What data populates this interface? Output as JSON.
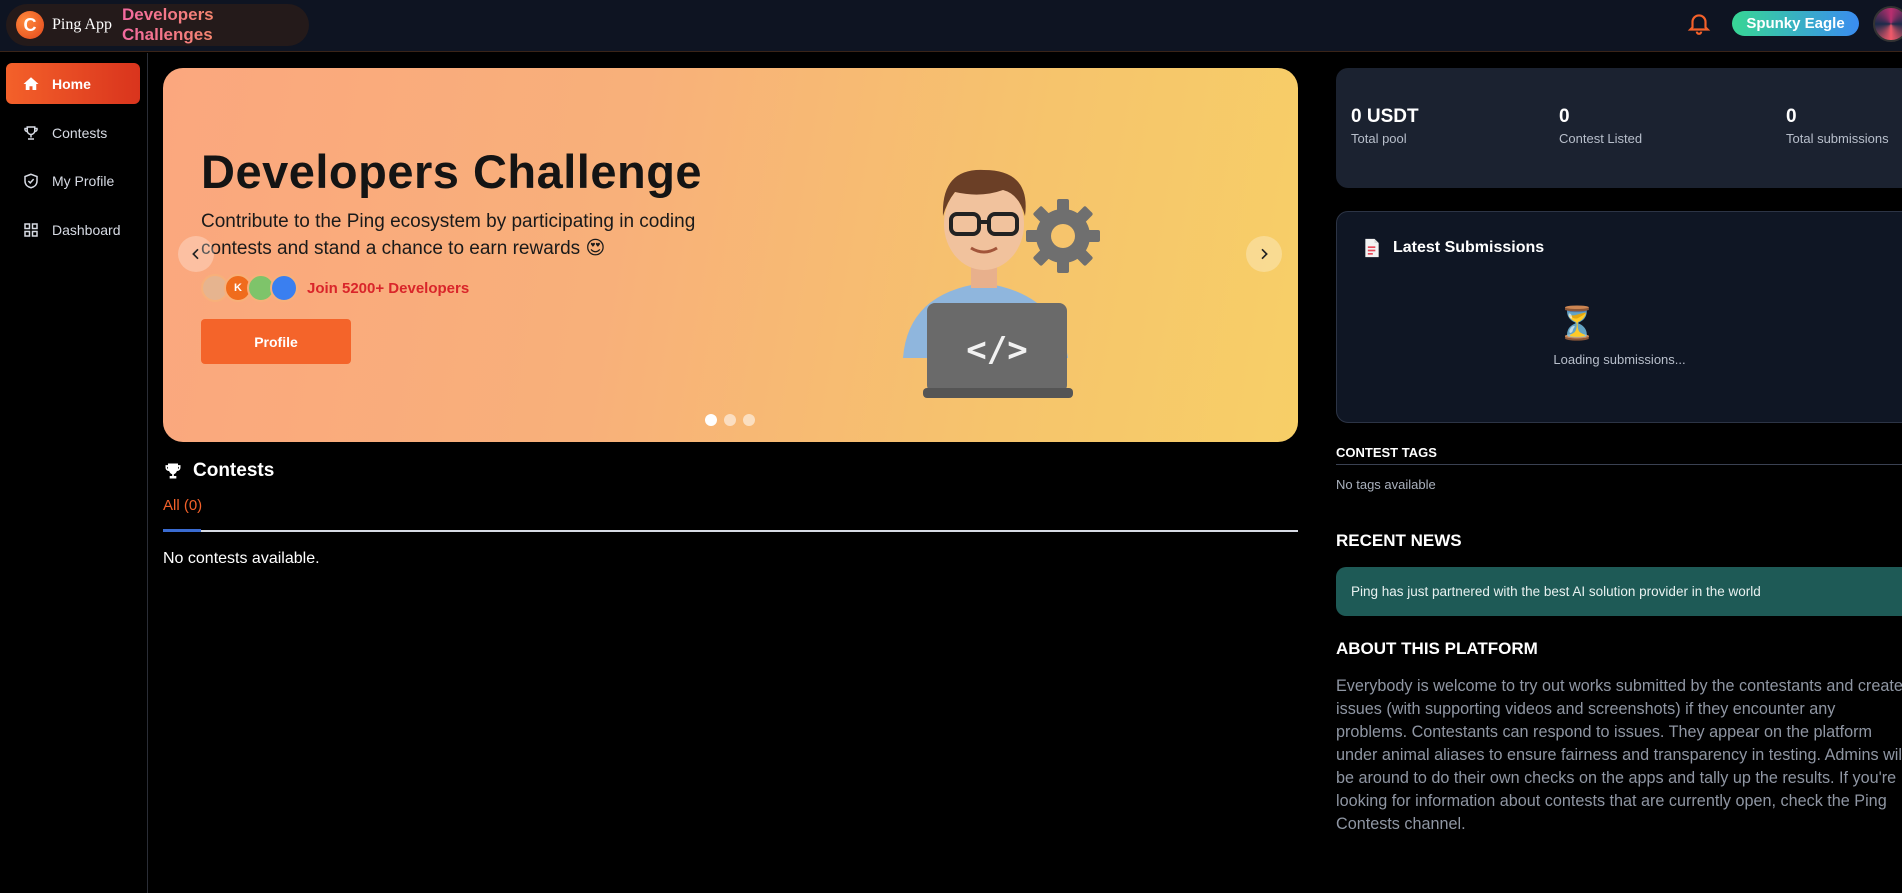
{
  "topbar": {
    "logo_letter": "C",
    "brand_name": "Ping App",
    "brand_sub": "Developers Challenges",
    "user_name": "Spunky Eagle"
  },
  "sidebar": {
    "items": [
      {
        "label": "Home",
        "icon": "home-icon",
        "active": true
      },
      {
        "label": "Contests",
        "icon": "trophy-icon",
        "active": false
      },
      {
        "label": "My Profile",
        "icon": "shield-check-icon",
        "active": false
      },
      {
        "label": "Dashboard",
        "icon": "grid-icon",
        "active": false
      }
    ]
  },
  "hero": {
    "title": "Developers Challenge",
    "description": "Contribute to the Ping ecosystem by participating in coding contests and stand a chance to earn rewards 😍",
    "avatar_letter": "K",
    "join_text": "Join 5200+ Developers",
    "button_label": "Profile",
    "slides": 3,
    "active_slide": 1
  },
  "contests": {
    "title": "Contests",
    "tab_all": "All (0)",
    "empty_text": "No contests available."
  },
  "stats": [
    {
      "value": "0 USDT",
      "label": "Total pool"
    },
    {
      "value": "0",
      "label": "Contest Listed"
    },
    {
      "value": "0",
      "label": "Total submissions"
    }
  ],
  "submissions": {
    "title": "Latest Submissions",
    "loading_icon": "⏳",
    "loading_text": "Loading submissions..."
  },
  "tags": {
    "heading": "CONTEST TAGS",
    "empty_text": "No tags available"
  },
  "news": {
    "heading": "RECENT NEWS",
    "items": [
      "Ping has just partnered with the best AI solution provider in the world"
    ]
  },
  "about": {
    "heading": "ABOUT THIS PLATFORM",
    "text": "Everybody is welcome to try out works submitted by the contestants and create issues (with supporting videos and screenshots) if they encounter any problems. Contestants can respond to issues. They appear on the platform under animal aliases to ensure fairness and transparency in testing. Admins will be around to do their own checks on the apps and tally up the results. If you're looking for information about contests that are currently open, check the Ping Contests channel."
  },
  "colors": {
    "accent": "#f4612a",
    "background": "#000000",
    "card": "#1b2230",
    "news_card": "#1e5a56"
  }
}
